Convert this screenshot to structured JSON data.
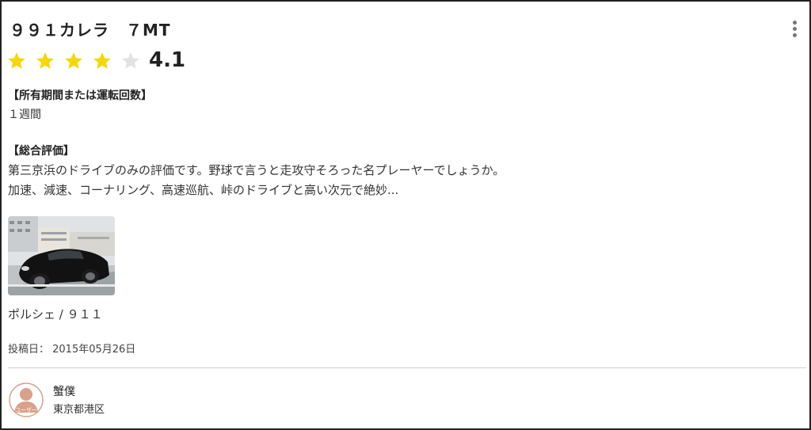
{
  "review": {
    "title": "９９１カレラ　７MT",
    "rating": {
      "value": "4.1",
      "stars_filled": 4,
      "stars_total": 5,
      "filled_color": "#f5d60a",
      "empty_color": "#e2e2e2"
    },
    "ownership": {
      "heading": "【所有期間または運転回数】",
      "text": "１週間"
    },
    "overall": {
      "heading": "【総合評価】",
      "line1": "第三京浜のドライブのみの評価です。野球で言うと走攻守そろった名プレーヤーでしょうか。",
      "line2": "加速、減速、コーナリング、高速巡航、峠のドライブと高い次元で絶妙..."
    },
    "car_model": "ポルシェ / ９１１",
    "posted": "投稿日： 2015年05月26日"
  },
  "user": {
    "name": "蟹僕",
    "location": "東京都港区",
    "avatar_label": "ユーザー",
    "avatar_color": "#d9a08a"
  },
  "menu": {
    "icon": "more-vertical-icon"
  }
}
